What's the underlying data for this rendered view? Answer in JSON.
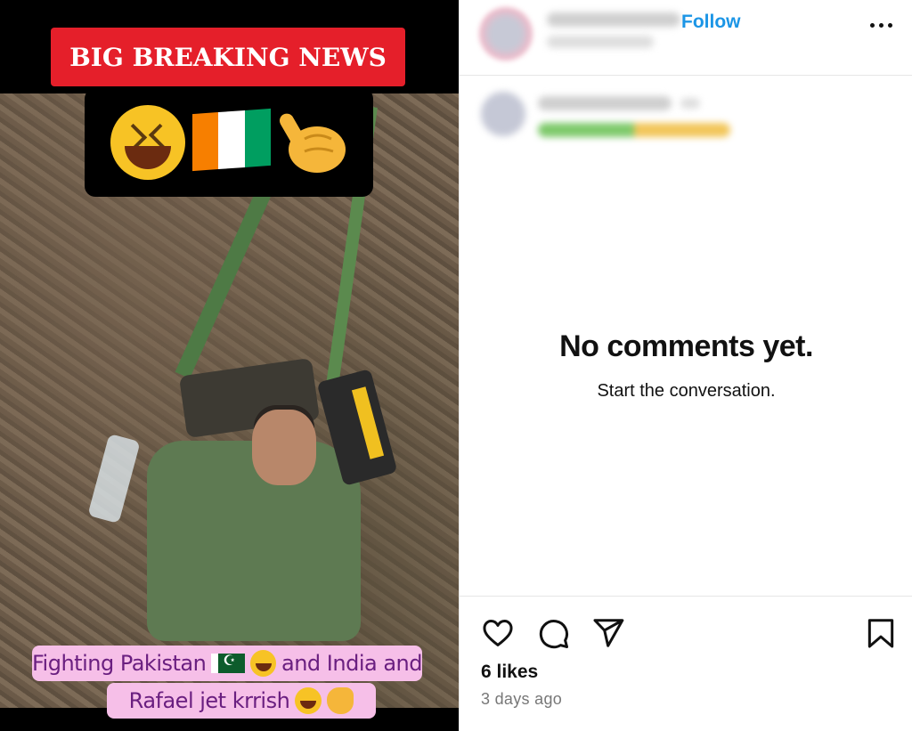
{
  "media": {
    "headline": "BIG BREAKING NEWS",
    "caption_line1_a": "Fighting Pakistan",
    "caption_line1_b": "and India and",
    "caption_line2": "Rafael jet krrish",
    "overlay_icons": [
      "laughing-emoji",
      "ivory-coast-flag",
      "pointing-hand-emoji"
    ],
    "colors": {
      "headline_bg": "#e51f2a",
      "caption_bg": "#f6bfe8",
      "caption_text": "#6a1f80"
    }
  },
  "post": {
    "follow_label": "Follow",
    "empty_title": "No comments yet.",
    "empty_subtitle": "Start the conversation.",
    "likes": "6 likes",
    "posted": "3 days ago",
    "actions": [
      "heart-icon",
      "comment-icon",
      "share-icon",
      "bookmark-icon"
    ],
    "accent": "#1b95e6"
  }
}
